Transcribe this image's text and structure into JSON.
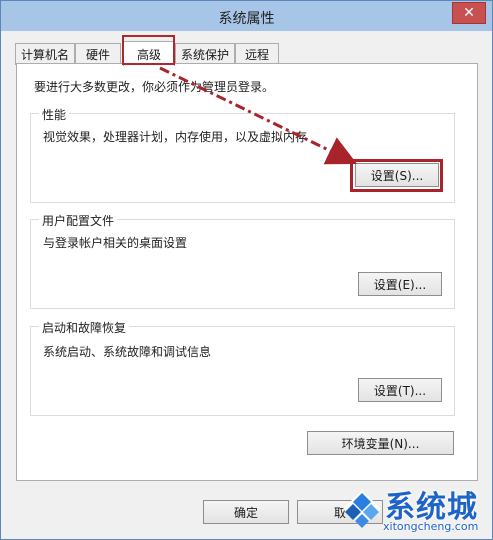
{
  "window": {
    "title": "系统属性",
    "close_glyph": "✕"
  },
  "tabs": [
    {
      "label": "计算机名"
    },
    {
      "label": "硬件"
    },
    {
      "label": "高级"
    },
    {
      "label": "系统保护"
    },
    {
      "label": "远程"
    }
  ],
  "active_tab": "高级",
  "admin_note": "要进行大多数更改，你必须作为管理员登录。",
  "performance": {
    "label": "性能",
    "description": "视觉效果，处理器计划，内存使用，以及虚拟内存",
    "button": "设置(S)..."
  },
  "user_profiles": {
    "label": "用户配置文件",
    "description": "与登录帐户相关的桌面设置",
    "button": "设置(E)..."
  },
  "startup_recovery": {
    "label": "启动和故障恢复",
    "description": "系统启动、系统故障和调试信息",
    "button": "设置(T)..."
  },
  "env_button": "环境变量(N)...",
  "footer": {
    "ok": "确定",
    "cancel": "取"
  },
  "watermark": {
    "brand": "系统城",
    "url": "xitongcheng.com"
  },
  "colors": {
    "highlight": "#a8232a",
    "titlebar": "#a7c5e6",
    "watermark": "#1e64c8"
  }
}
